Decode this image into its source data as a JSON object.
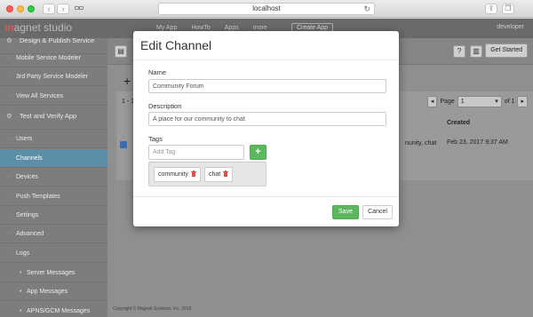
{
  "browser": {
    "url": "localhost",
    "back_icon": "chevron-left-icon",
    "forward_icon": "chevron-right-icon"
  },
  "app": {
    "logo_prefix": "m",
    "logo_text": "agnet studio",
    "tabs": [
      "My App",
      "HowTo",
      "Apps",
      "more"
    ],
    "create_app_label": "Create App",
    "user_label": "developer"
  },
  "sidebar": {
    "items": [
      {
        "label": "Design & Publish Service",
        "kind": "section"
      },
      {
        "label": "Mobile Service Modeler",
        "kind": "item"
      },
      {
        "label": "3rd Party Service Modeler",
        "kind": "item"
      },
      {
        "label": "View All Services",
        "kind": "item"
      },
      {
        "label": "Test and Verify App",
        "kind": "section"
      },
      {
        "label": "Users",
        "kind": "item"
      },
      {
        "label": "Channels",
        "kind": "active"
      },
      {
        "label": "Devices",
        "kind": "item"
      },
      {
        "label": "Push Templates",
        "kind": "item"
      },
      {
        "label": "Settings",
        "kind": "item"
      },
      {
        "label": "Advanced",
        "kind": "item"
      },
      {
        "label": "Logs",
        "kind": "item"
      },
      {
        "label": "Server Messages",
        "kind": "sub"
      },
      {
        "label": "App Messages",
        "kind": "sub"
      },
      {
        "label": "APNS/GCM Messages",
        "kind": "sub"
      }
    ]
  },
  "toolbar": {
    "help_label": "?",
    "get_started_label": "Get Started"
  },
  "table": {
    "count_text": "1 - 1",
    "page_label": "Page",
    "page_value": "1",
    "page_of": "of 1",
    "created_header": "Created",
    "row_cell": "nunity, chat",
    "row_created": "Feb 23, 2017 9:37 AM"
  },
  "footer": {
    "text": "Copyright © Magnet Systems, Inc. 2016"
  },
  "modal": {
    "title": "Edit Channel",
    "name_label": "Name",
    "name_value": "Community Forum",
    "description_label": "Description",
    "description_value": "A place for our community to chat",
    "tags_label": "Tags",
    "add_tag_placeholder": "Add Tag",
    "add_tag_button": "+",
    "tags": [
      "community",
      "chat"
    ],
    "save_label": "Save",
    "cancel_label": "Cancel"
  },
  "colors": {
    "primary_green": "#5cb85c",
    "active_sidebar": "#5d8ea8",
    "trash_red": "#d9534f"
  }
}
